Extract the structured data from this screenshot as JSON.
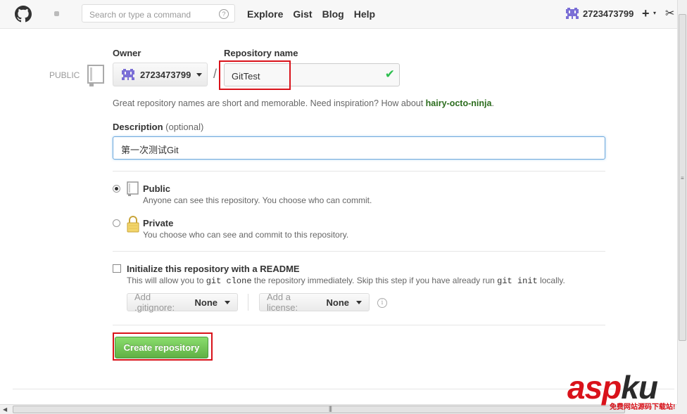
{
  "header": {
    "search_placeholder": "Search or type a command",
    "search_help": "?",
    "nav": [
      "Explore",
      "Gist",
      "Blog",
      "Help"
    ],
    "username": "2723473799",
    "plus": "+",
    "plus_caret": "▾",
    "tools": "✂"
  },
  "form": {
    "visibility_tag": "PUBLIC",
    "owner_label": "Owner",
    "owner_value": "2723473799",
    "slash": "/",
    "repo_name_label": "Repository name",
    "repo_name_value": "GitTest",
    "valid_check": "✔",
    "hint_prefix": "Great repository names are short and memorable. Need inspiration? How about ",
    "hint_suggestion": "hairy-octo-ninja",
    "hint_suffix": ".",
    "description_label": "Description",
    "description_optional": "(optional)",
    "description_value": "第一次测试Git",
    "public_title": "Public",
    "public_desc": "Anyone can see this repository. You choose who can commit.",
    "private_title": "Private",
    "private_desc": "You choose who can see and commit to this repository.",
    "selected_visibility": "Public",
    "init_title": "Initialize this repository with a README",
    "init_desc_1": "This will allow you to ",
    "init_code_1": "git clone",
    "init_desc_2": " the repository immediately. Skip this step if you have already run ",
    "init_code_2": "git init",
    "init_desc_3": " locally.",
    "init_checked": false,
    "gitignore_label": "Add .gitignore:",
    "gitignore_value": "None",
    "license_label": "Add a license:",
    "license_value": "None",
    "info": "i",
    "create_button": "Create repository"
  },
  "colors": {
    "accent_green": "#60b044",
    "highlight_red": "#d9121a",
    "suggestion_green": "#2b6c1d"
  },
  "scrollbars": {
    "v_grip": "≡",
    "h_grip": "|||",
    "h_arrow": "◀"
  },
  "watermark": {
    "part1": "asp",
    "part2": "ku",
    "tail": ".com",
    "sub": "免费网站源码下载站!"
  }
}
